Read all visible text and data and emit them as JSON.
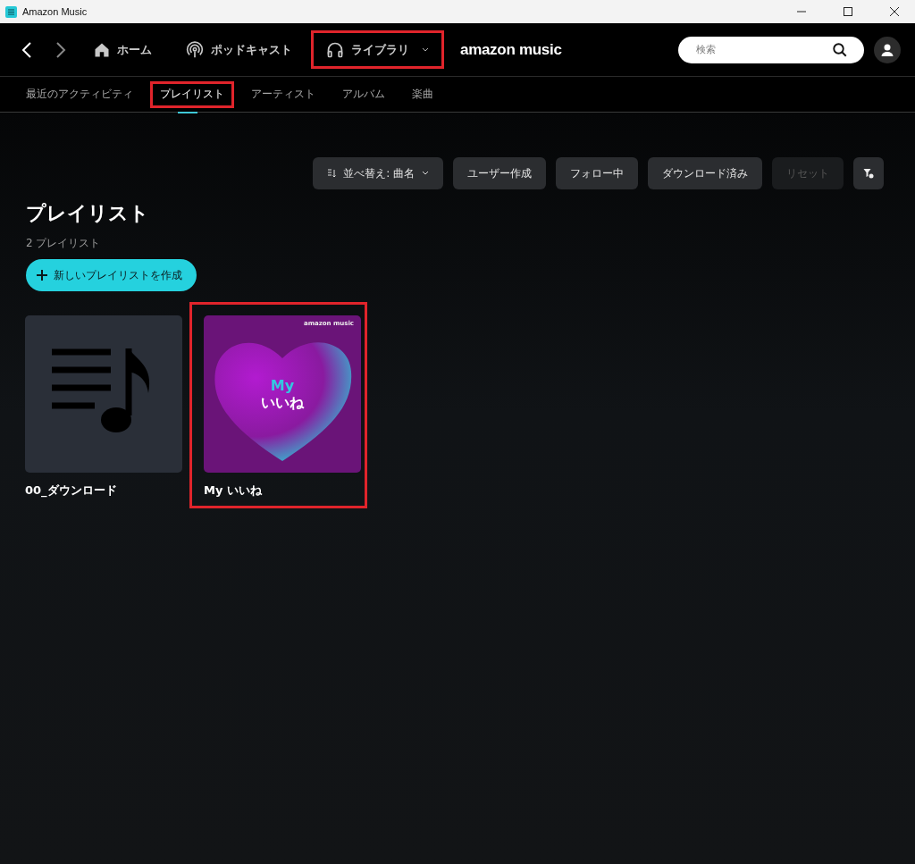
{
  "window": {
    "title": "Amazon Music"
  },
  "nav": {
    "items": [
      {
        "kind": "home",
        "label": "ホーム",
        "highlighted": false
      },
      {
        "kind": "podcast",
        "label": "ポッドキャスト",
        "highlighted": false
      },
      {
        "kind": "library",
        "label": "ライブラリ",
        "highlighted": true
      }
    ],
    "logo": "amazon music",
    "search": {
      "placeholder": "検索"
    }
  },
  "tabs": [
    {
      "label": "最近のアクティビティ",
      "selected": false,
      "highlighted": false
    },
    {
      "label": "プレイリスト",
      "selected": true,
      "highlighted": true
    },
    {
      "label": "アーティスト",
      "selected": false,
      "highlighted": false
    },
    {
      "label": "アルバム",
      "selected": false,
      "highlighted": false
    },
    {
      "label": "楽曲",
      "selected": false,
      "highlighted": false
    }
  ],
  "filters": [
    {
      "kind": "sort",
      "label": "並べ替え: 曲名",
      "disabled": false
    },
    {
      "kind": "plain",
      "label": "ユーザー作成",
      "disabled": false
    },
    {
      "kind": "plain",
      "label": "フォロー中",
      "disabled": false
    },
    {
      "kind": "plain",
      "label": "ダウンロード済み",
      "disabled": false
    },
    {
      "kind": "plain",
      "label": "リセット",
      "disabled": true
    },
    {
      "kind": "icon",
      "disabled": false
    }
  ],
  "heading": "プレイリスト",
  "count": "2 プレイリスト",
  "create_button": "新しいプレイリストを作成",
  "playlists": [
    {
      "kind": "generic",
      "title": "00_ダウンロード",
      "highlighted": false
    },
    {
      "kind": "cover",
      "title": "My いいね",
      "cover_logo": "amazon music",
      "cover_lines": [
        "My",
        "いいね"
      ],
      "highlighted": true
    }
  ]
}
